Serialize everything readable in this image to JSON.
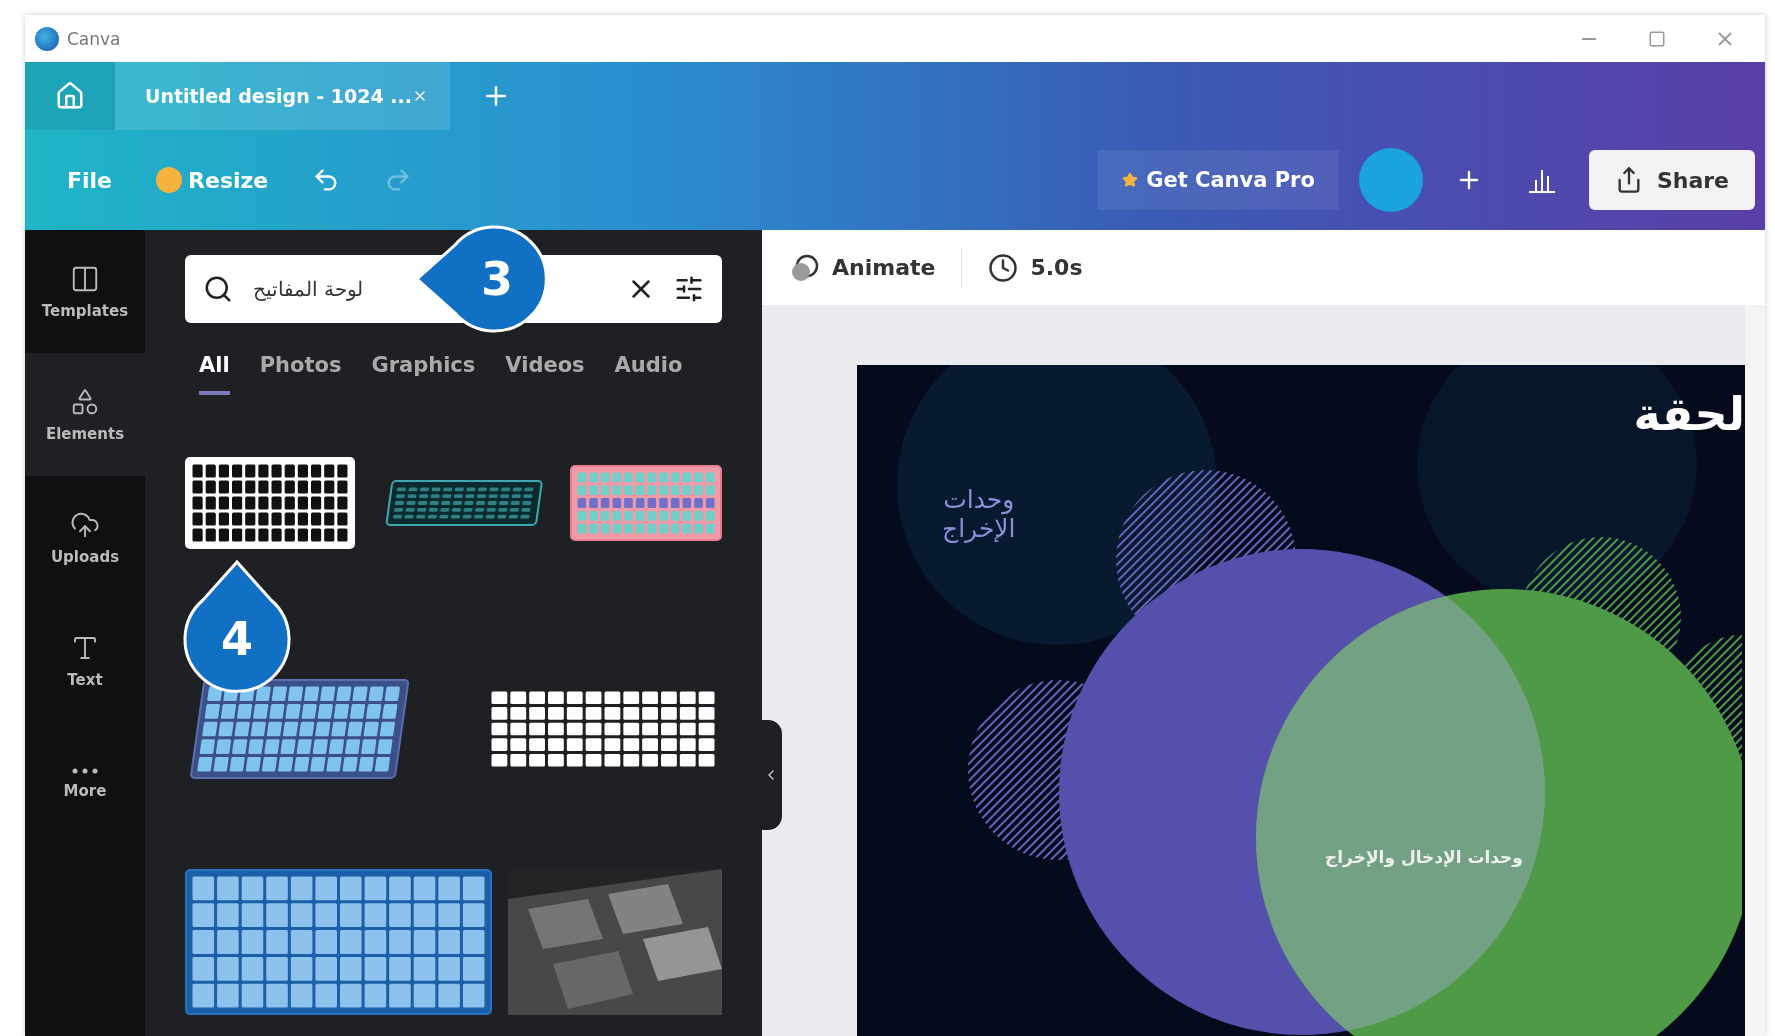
{
  "window": {
    "title": "Canva"
  },
  "tabs": [
    {
      "label": "Untitled design - 1024 ...",
      "selected": true
    }
  ],
  "toolbar": {
    "file": "File",
    "resize": "Resize",
    "pro": "Get Canva Pro",
    "share": "Share"
  },
  "rail": [
    {
      "label": "Templates",
      "selected": false
    },
    {
      "label": "Elements",
      "selected": true
    },
    {
      "label": "Uploads",
      "selected": false
    },
    {
      "label": "Text",
      "selected": false
    },
    {
      "label": "More",
      "selected": false
    }
  ],
  "search": {
    "value": "لوحة المفاتيح"
  },
  "filters": [
    {
      "label": "All",
      "selected": true
    },
    {
      "label": "Photos",
      "selected": false
    },
    {
      "label": "Graphics",
      "selected": false
    },
    {
      "label": "Videos",
      "selected": false
    },
    {
      "label": "Audio",
      "selected": false
    }
  ],
  "results": [
    [
      {
        "kind": "outline"
      },
      {
        "kind": "teal"
      },
      {
        "kind": "pink"
      }
    ],
    [
      {
        "kind": "blue3d"
      },
      {
        "kind": "whitekeys"
      }
    ],
    [
      {
        "kind": "flatblue"
      },
      {
        "kind": "picture"
      }
    ]
  ],
  "editor": {
    "animate": "Animate",
    "duration": "5.0s"
  },
  "design": {
    "title": "لحقة",
    "label": "وحدات\nالإخراج",
    "center_label": "وحدات الإدخال والإخراج"
  },
  "callouts": [
    {
      "number": "3"
    },
    {
      "number": "4"
    }
  ]
}
